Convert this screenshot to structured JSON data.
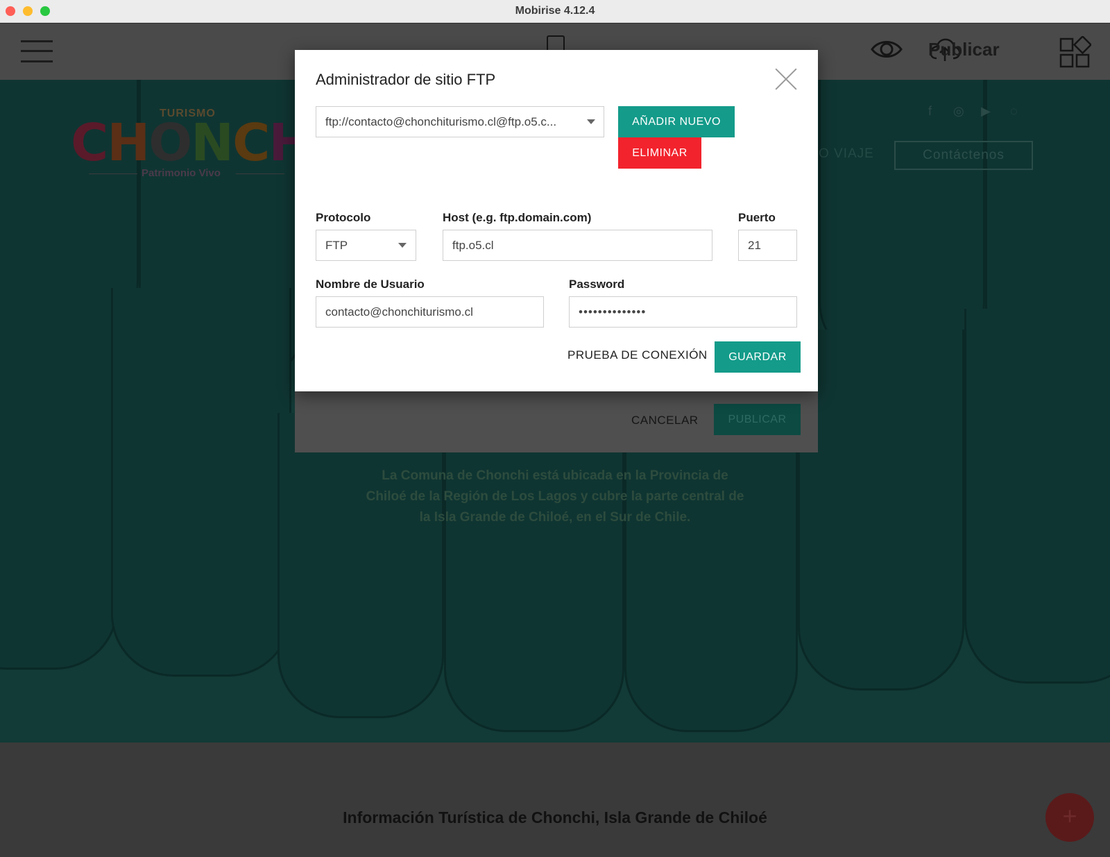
{
  "window": {
    "title": "Mobirise 4.12.4"
  },
  "toolbar": {
    "publish_label": "Publicar",
    "icons": [
      "menu-icon",
      "mobile-device-icon",
      "eye-icon",
      "cloud-upload-icon",
      "blocks-icon"
    ]
  },
  "site": {
    "logo_top": "TURISMO",
    "logo_main": "CHONCHI",
    "logo_sub": "Patrimonio Vivo",
    "nav_partial": "O VIAJE",
    "contact_button": "Contáctenos",
    "hero_text": "La Comuna de Chonchi está ubicada en la Provincia de Chiloé de la Región de Los Lagos y cubre la parte central de la Isla Grande de Chiloé, en el Sur de Chile.",
    "section_title": "Información Turística de Chonchi, Isla Grande de Chiloé",
    "social_icons": [
      "facebook-icon",
      "instagram-icon",
      "youtube-icon",
      "whatsapp-icon"
    ],
    "fab_label": "+"
  },
  "publish_dialog": {
    "cancel_label": "CANCELAR",
    "publish_label": "PUBLICAR"
  },
  "ftp_modal": {
    "title": "Administrador de sitio FTP",
    "site_select_value": "ftp://contacto@chonchiturismo.cl@ftp.o5.c...",
    "add_button": "AÑADIR NUEVO",
    "delete_button": "ELIMINAR",
    "protocol_label": "Protocolo",
    "protocol_value": "FTP",
    "host_label": "Host (e.g. ftp.domain.com)",
    "host_value": "ftp.o5.cl",
    "port_label": "Puerto",
    "port_value": "21",
    "username_label": "Nombre de Usuario",
    "username_value": "contacto@chonchiturismo.cl",
    "password_label": "Password",
    "password_value": "••••••••••••••",
    "test_connection": "PRUEBA DE CONEXIÓN",
    "save_button": "GUARDAR"
  },
  "colors": {
    "accent": "#149b8a",
    "danger": "#f2232d",
    "background_site": "#123a36"
  }
}
